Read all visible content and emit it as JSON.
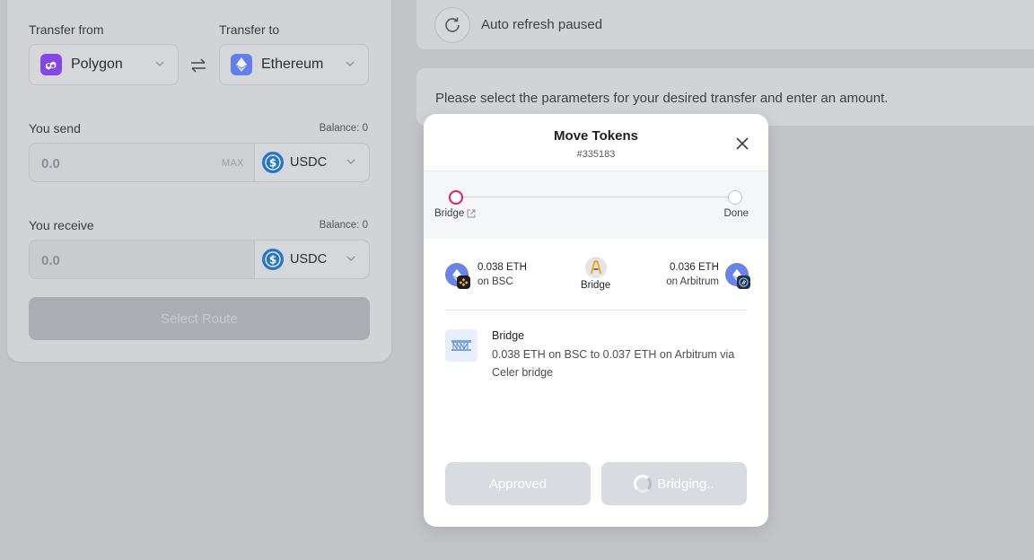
{
  "transfer": {
    "from_label": "Transfer from",
    "to_label": "Transfer to",
    "from_network": "Polygon",
    "to_network": "Ethereum",
    "send_label": "You send",
    "send_balance": "Balance: 0",
    "send_amount": "0.0",
    "max_label": "MAX",
    "send_token": "USDC",
    "receive_label": "You receive",
    "receive_balance": "Balance: 0",
    "receive_amount": "0.0",
    "receive_token": "USDC",
    "select_route": "Select Route"
  },
  "refresh": {
    "text": "Auto refresh paused"
  },
  "info": {
    "text": "Please select the parameters for your desired transfer and enter an amount."
  },
  "modal": {
    "title": "Move Tokens",
    "subtitle": "#335183",
    "steps": {
      "left": "Bridge",
      "right": "Done"
    },
    "route": {
      "from_amount": "0.038 ETH",
      "from_chain": "on BSC",
      "via": "Bridge",
      "to_amount": "0.036 ETH",
      "to_chain": "on Arbitrum"
    },
    "step": {
      "title": "Bridge",
      "description": "0.038 ETH on BSC to 0.037 ETH on Arbitrum via Celer bridge"
    },
    "buttons": {
      "approved": "Approved",
      "bridging": "Bridging.."
    }
  },
  "colors": {
    "accent": "#e6176f",
    "polygon": "#8247e5",
    "ethereum": "#627eea",
    "usdc": "#2775ca"
  }
}
